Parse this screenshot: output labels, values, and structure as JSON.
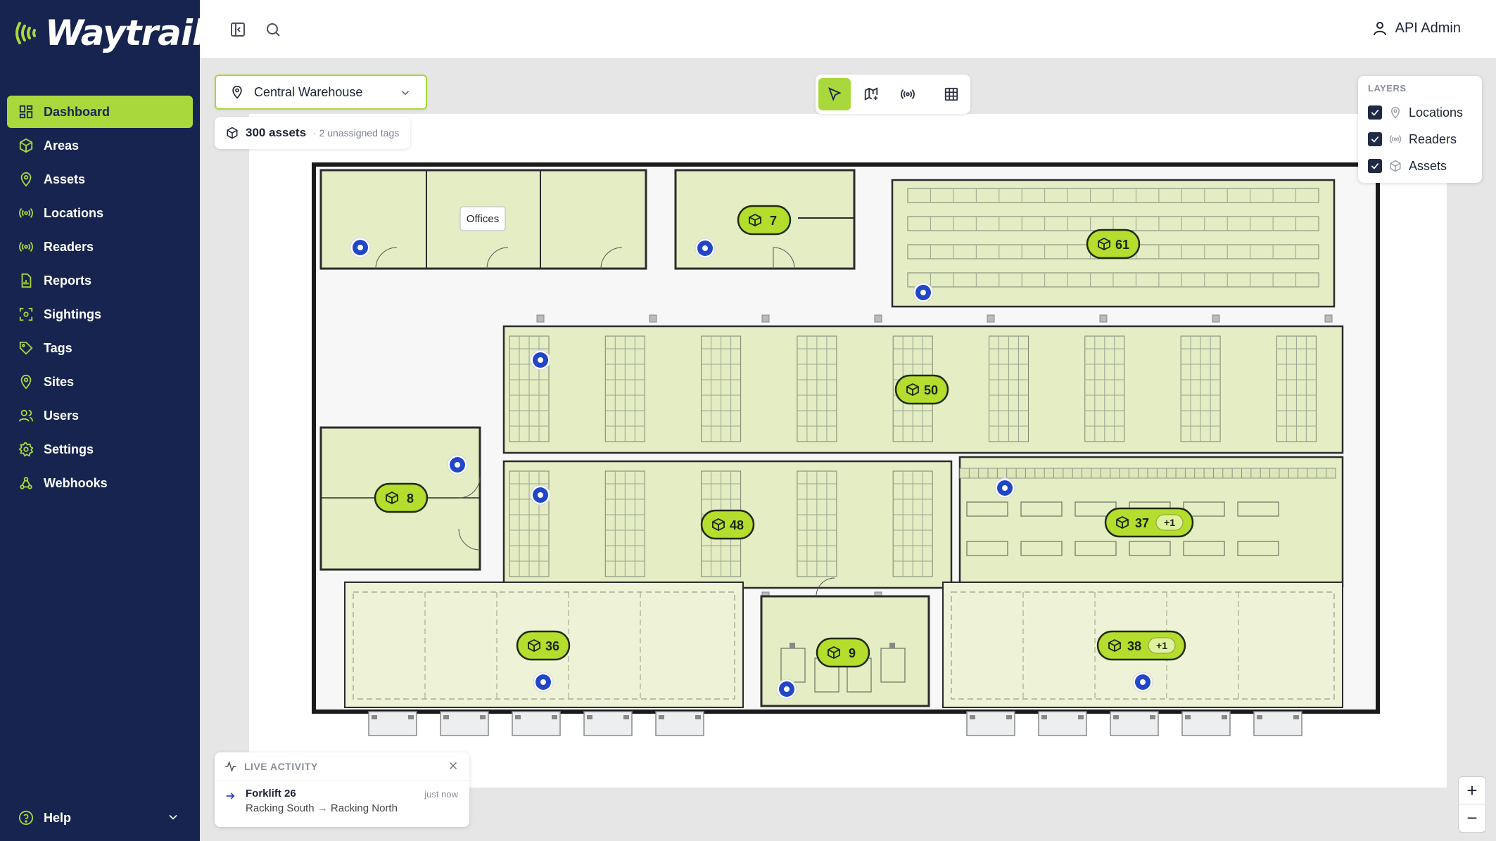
{
  "app": {
    "brand": "Waytrail",
    "user": "API Admin"
  },
  "sidebar": {
    "items": [
      {
        "label": "Dashboard",
        "icon": "dashboard-icon",
        "active": true
      },
      {
        "label": "Areas",
        "icon": "cube-icon"
      },
      {
        "label": "Assets",
        "icon": "map-pin-icon"
      },
      {
        "label": "Locations",
        "icon": "broadcast-icon"
      },
      {
        "label": "Readers",
        "icon": "broadcast-icon"
      },
      {
        "label": "Reports",
        "icon": "report-icon"
      },
      {
        "label": "Sightings",
        "icon": "target-icon"
      },
      {
        "label": "Tags",
        "icon": "tag-icon"
      },
      {
        "label": "Sites",
        "icon": "map-pin-icon"
      },
      {
        "label": "Users",
        "icon": "users-icon"
      },
      {
        "label": "Settings",
        "icon": "gear-icon"
      },
      {
        "label": "Webhooks",
        "icon": "webhook-icon"
      }
    ],
    "help_label": "Help"
  },
  "map": {
    "site": "Central Warehouse",
    "asset_count": "300 assets",
    "unassigned": "· 2 unassigned tags",
    "tools": [
      "select-tool",
      "map-edit-tool",
      "readers-tool",
      "grid-tool"
    ],
    "active_tool": "select-tool",
    "office_label": "Offices",
    "clusters": [
      {
        "id": "c7",
        "count": "7",
        "extra": ""
      },
      {
        "id": "c61",
        "count": "61",
        "extra": ""
      },
      {
        "id": "c50",
        "count": "50",
        "extra": ""
      },
      {
        "id": "c8",
        "count": "8",
        "extra": ""
      },
      {
        "id": "c48",
        "count": "48",
        "extra": ""
      },
      {
        "id": "c37",
        "count": "37",
        "extra": "+1"
      },
      {
        "id": "c36",
        "count": "36",
        "extra": ""
      },
      {
        "id": "c9",
        "count": "9",
        "extra": ""
      },
      {
        "id": "c38",
        "count": "38",
        "extra": "+1"
      }
    ]
  },
  "layers": {
    "title": "LAYERS",
    "items": [
      {
        "label": "Locations",
        "checked": true
      },
      {
        "label": "Readers",
        "checked": true
      },
      {
        "label": "Assets",
        "checked": true
      }
    ]
  },
  "zoom": {
    "in": "+",
    "out": "−"
  },
  "activity": {
    "title": "LIVE ACTIVITY",
    "name": "Forklift 26",
    "from": "Racking South",
    "arrow": "→",
    "to": "Racking North",
    "time": "just now"
  },
  "colors": {
    "sidebar": "#16244f",
    "accent": "#a9d83c",
    "zone": "#eaf2cf",
    "reader": "#2146c7"
  }
}
